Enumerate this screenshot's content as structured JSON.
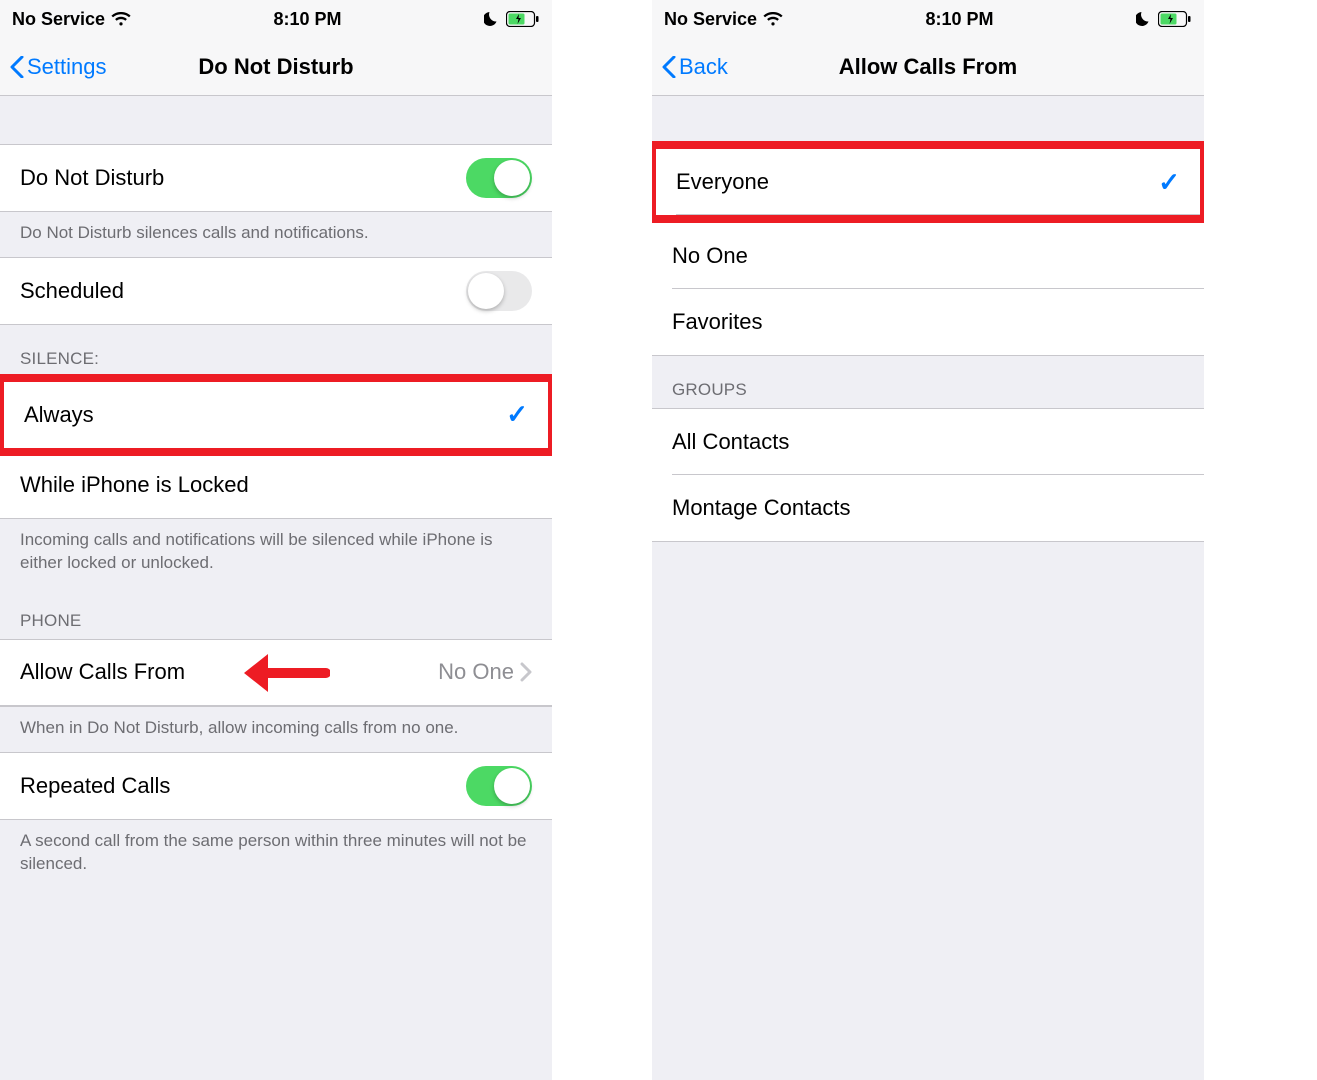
{
  "status": {
    "service": "No Service",
    "time": "8:10 PM"
  },
  "left": {
    "nav_back": "Settings",
    "nav_title": "Do Not Disturb",
    "dnd": {
      "label": "Do Not Disturb",
      "on": true,
      "footer": "Do Not Disturb silences calls and notifications."
    },
    "scheduled": {
      "label": "Scheduled",
      "on": false
    },
    "silence": {
      "header": "SILENCE:",
      "options": [
        {
          "label": "Always",
          "checked": true
        },
        {
          "label": "While iPhone is Locked",
          "checked": false
        }
      ],
      "footer": "Incoming calls and notifications will be silenced while iPhone is either locked or unlocked."
    },
    "phone": {
      "header": "PHONE",
      "allow_calls": {
        "label": "Allow Calls From",
        "value": "No One",
        "footer": "When in Do Not Disturb, allow incoming calls from no one."
      },
      "repeated": {
        "label": "Repeated Calls",
        "on": true,
        "footer": "A second call from the same person within three minutes will not be silenced."
      }
    }
  },
  "right": {
    "nav_back": "Back",
    "nav_title": "Allow Calls From",
    "top_options": [
      {
        "label": "Everyone",
        "checked": true
      },
      {
        "label": "No One",
        "checked": false
      },
      {
        "label": "Favorites",
        "checked": false
      }
    ],
    "groups": {
      "header": "GROUPS",
      "options": [
        {
          "label": "All Contacts",
          "checked": false
        },
        {
          "label": "Montage Contacts",
          "checked": false
        }
      ]
    }
  },
  "colors": {
    "accent": "#007aff",
    "toggle_on": "#4cd964",
    "annotation": "#ed1c24"
  }
}
